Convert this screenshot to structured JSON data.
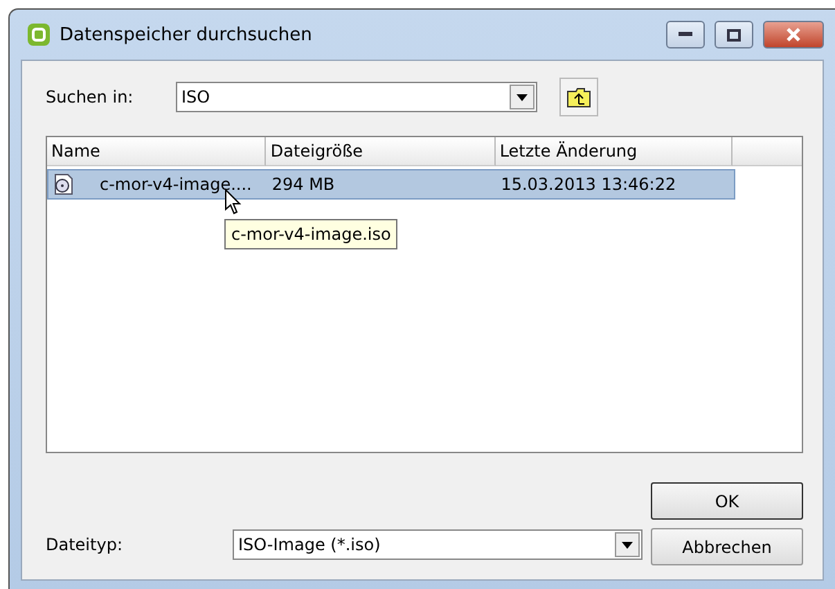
{
  "window": {
    "title": "Datenspeicher durchsuchen"
  },
  "look_in": {
    "label": "Suchen in:",
    "value": "ISO"
  },
  "file_list": {
    "columns": [
      "Name",
      "Dateigröße",
      "Letzte Änderung"
    ],
    "rows": [
      {
        "name": "c-mor-v4-image....",
        "size": "294 MB",
        "modified": "15.03.2013 13:46:22",
        "selected": true
      }
    ],
    "tooltip": "c-mor-v4-image.iso"
  },
  "file_type": {
    "label": "Dateityp:",
    "value": "ISO-Image (*.iso)"
  },
  "buttons": [
    "OK",
    "Abbrechen"
  ]
}
